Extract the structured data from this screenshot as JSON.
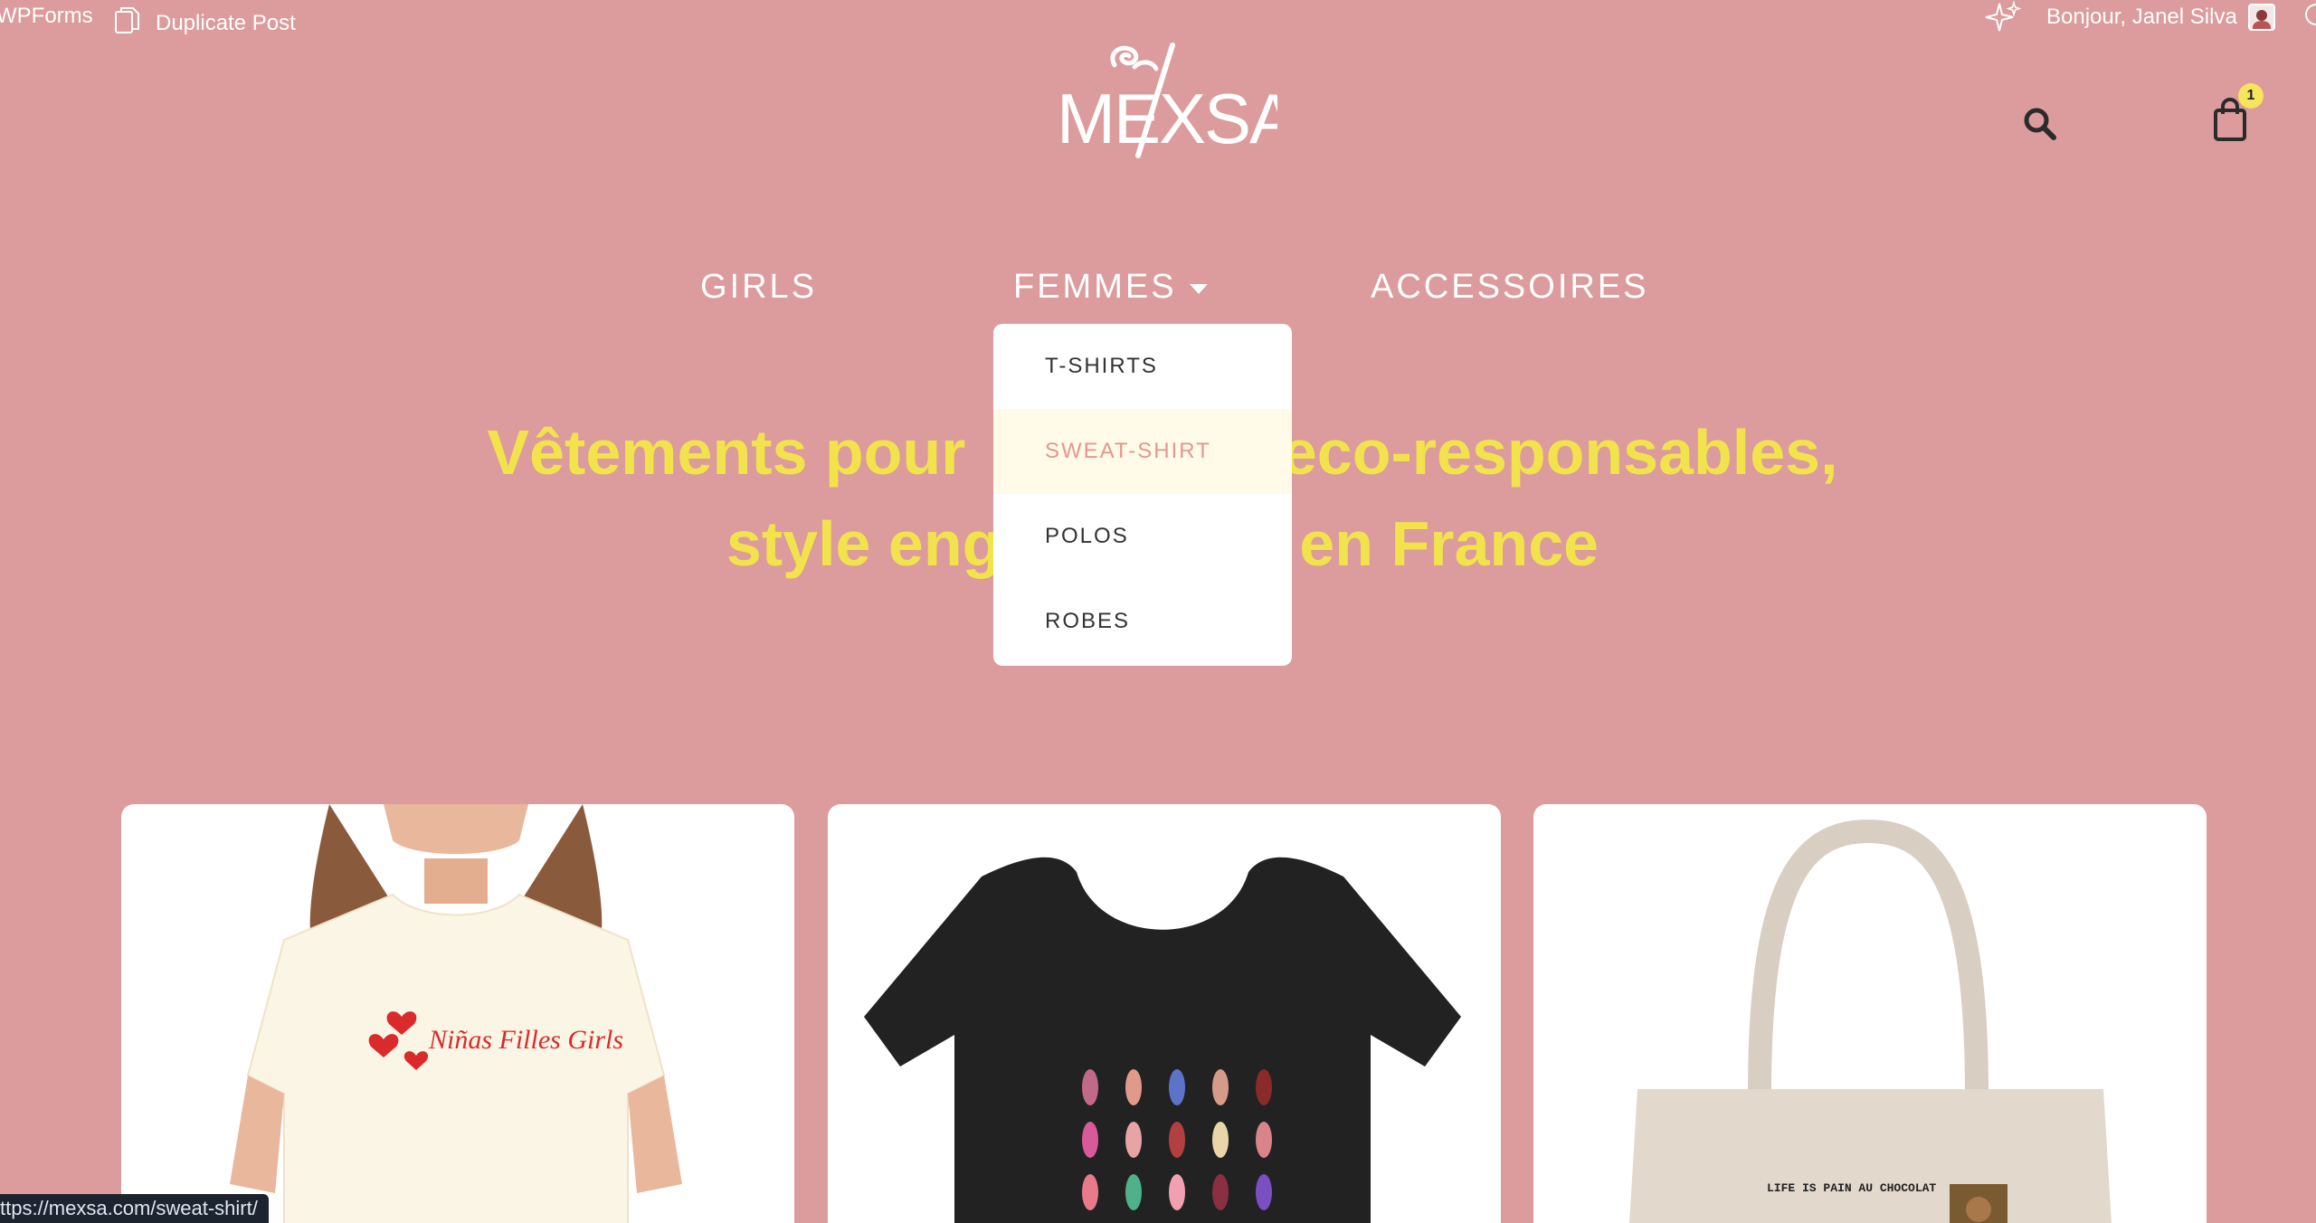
{
  "adminbar": {
    "wpforms": "WPForms",
    "duplicate_post": "Duplicate Post",
    "greeting": "Bonjour, Janel Silva"
  },
  "brand": {
    "logo_text": "MEXSA"
  },
  "cart": {
    "count": "1"
  },
  "nav": {
    "girls": "GIRLS",
    "femmes": "FEMMES",
    "accessoires": "ACCESSOIRES"
  },
  "dropdown": {
    "items": [
      {
        "label": "T-SHIRTS"
      },
      {
        "label": "SWEAT-SHIRT"
      },
      {
        "label": "POLOS"
      },
      {
        "label": "ROBES"
      }
    ]
  },
  "hero": {
    "line1_left": "Vêtements pour ",
    "line1_right": "eco-responsables,",
    "line2_left": "style eng",
    "line2_right": "en France"
  },
  "products": {
    "tshirt_print": "Niñas Filles Girls",
    "bag_text": "LIFE IS PAIN AU CHOCOLAT"
  },
  "status": {
    "url": "ttps://mexsa.com/sweat-shirt/"
  },
  "colors": {
    "background": "#dc9b9c",
    "hero_text": "#f2e34c",
    "dropdown_active_text": "#e5968f",
    "badge": "#f7e45d"
  }
}
